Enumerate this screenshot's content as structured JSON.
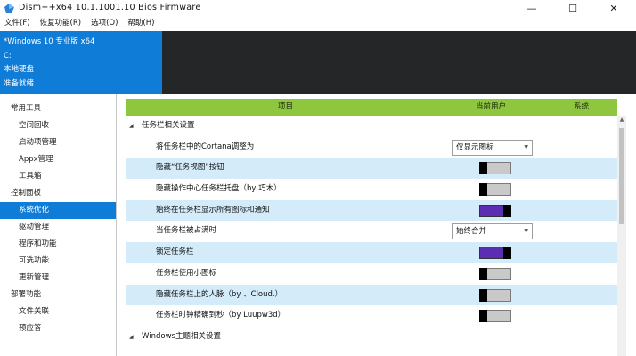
{
  "window": {
    "title": "Dism++x64 10.1.1001.10 Bios Firmware",
    "minimize": "—",
    "maximize": "☐",
    "close": "✕"
  },
  "menu": [
    "文件(F)",
    "恢复功能(R)",
    "选项(O)",
    "帮助(H)"
  ],
  "os_info": {
    "name": "*Windows 10 专业版 x64",
    "drive": "C:",
    "disk": "本地硬盘",
    "status": "准备就绪"
  },
  "sidebar": {
    "common_tools": "常用工具",
    "common_items": [
      "空间回收",
      "启动项管理",
      "Appx管理",
      "工具箱"
    ],
    "control_panel": "控制面板",
    "control_items": [
      "系统优化",
      "驱动管理",
      "程序和功能",
      "可选功能",
      "更新管理"
    ],
    "deploy": "部署功能",
    "deploy_items": [
      "文件关联",
      "预应答"
    ]
  },
  "columns": {
    "item": "项目",
    "current_user": "当前用户",
    "system": "系统"
  },
  "group1": "任务栏相关设置",
  "rows": [
    {
      "label": "将任务栏中的Cortana调整为",
      "dropdown": "仅显示图标"
    },
    {
      "label": "隐藏“任务视图”按钮",
      "on": false
    },
    {
      "label": "隐藏操作中心任务栏托盘（by 巧木）",
      "on": false
    },
    {
      "label": "始终在任务栏显示所有图标和通知",
      "on": true
    },
    {
      "label": "当任务栏被占满时",
      "dropdown": "始终合并"
    },
    {
      "label": "锁定任务栏",
      "on": true
    },
    {
      "label": "任务栏使用小图标",
      "on": false
    },
    {
      "label": "隐藏任务栏上的人脉（by 、Cloud.）",
      "on": false
    },
    {
      "label": "任务栏时钟精确到秒（by Luupw3d）",
      "on": false
    }
  ],
  "group2": "Windows主题相关设置",
  "colors": {
    "accent": "#0f7cd8",
    "header": "#8ec63f",
    "toggle_on": "#5b2db3",
    "row_alt": "#d4ebfa"
  }
}
